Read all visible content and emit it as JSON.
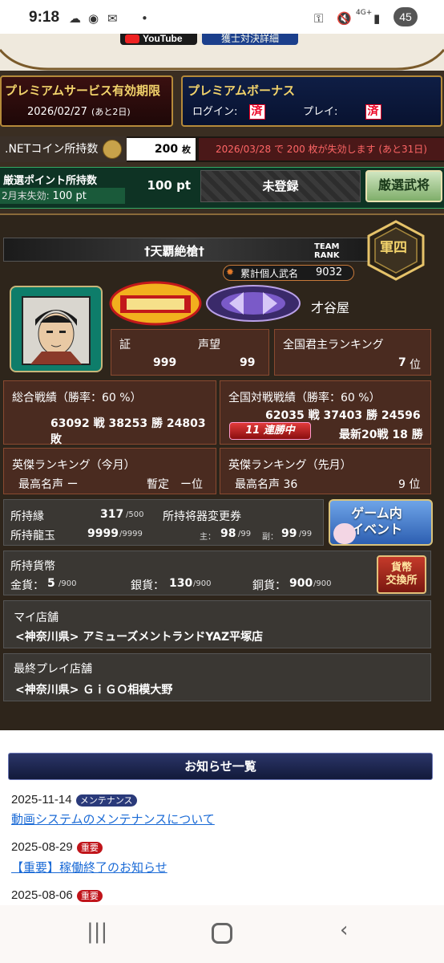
{
  "status": {
    "time": "9:18",
    "battery": "45",
    "network": "4G+"
  },
  "top": {
    "youtube_label": "YouTube",
    "youtube_btn": "獲士対決詳細"
  },
  "premium": {
    "title": "プレミアムサービス有効期限",
    "date": "2026/02/27",
    "remaining": "(あと2日)",
    "bonus_title": "プレミアムボーナス",
    "login_label": "ログイン:",
    "login_val": "済",
    "play_label": "プレイ:",
    "play_val": "済"
  },
  "coin": {
    "label": ".NETコイン所持数",
    "value": "200",
    "unit": "枚",
    "expire": "2026/03/28 で 200 枚が失効します (あと31日)"
  },
  "points": {
    "label": "厳選ポイント所持数",
    "expire_label": "2月末失効:",
    "expire_val": "100 pt",
    "value": "100 pt",
    "unregistered": "未登録",
    "button": "厳選武将"
  },
  "profile": {
    "title": "†天覇絶槍†",
    "team_rank_label": "TEAM\nRANK",
    "rank_glyph": "軍四",
    "heimei_label": "累計個人武名",
    "heimei_value": "9032",
    "store_name": "才谷屋"
  },
  "stats": {
    "shou_label": "証",
    "seibou_label": "声望",
    "shou_val": "999",
    "seibou_val": "99",
    "kunshu_label": "全国君主ランキング",
    "kunshu_val": "7",
    "kunshu_unit": "位",
    "sougo_label": "総合戦績（勝率：60 %）",
    "sougo_vals": "63092 戦 38253 勝 24803 敗",
    "zenkoku_label": "全国対戦戦績（勝率：60 %）",
    "zenkoku_vals": "62035 戦 37403 勝 24596 敗",
    "streak": "11 連勝中",
    "recent20": "最新20戦 18 勝",
    "eiketsu_now_label": "英傑ランキング（今月）",
    "eiketsu_now_meisei": "最高名声 ー",
    "eiketsu_now_rank": "暫定　ー位",
    "eiketsu_prev_label": "英傑ランキング（先月）",
    "eiketsu_prev_meisei": "最高名声 36",
    "eiketsu_prev_rank": "9 位"
  },
  "holdings": {
    "en_label": "所持縁",
    "en_val": "317",
    "en_max": "/500",
    "ryugyoku_label": "所持龍玉",
    "ryugyoku_val": "9999",
    "ryugyoku_max": "/9999",
    "shoki_label": "所持将器変更券",
    "shu_label": "主：",
    "shu_val": "98",
    "shu_max": "/99",
    "fuku_label": "副：",
    "fuku_val": "99",
    "fuku_max": "/99",
    "event_button": "ゲーム内\nイベント"
  },
  "currency": {
    "label": "所持貨幣",
    "gold_label": "金貨：",
    "gold_val": "5",
    "gold_max": "/900",
    "silver_label": "銀貨：",
    "silver_val": "130",
    "silver_max": "/900",
    "copper_label": "銅貨：",
    "copper_val": "900",
    "copper_max": "/900",
    "exchange_button": "貨幣\n交換所"
  },
  "stores": {
    "my_label": "マイ店舗",
    "my_value": "<神奈川県> アミューズメントランドYAZ平塚店",
    "last_label": "最終プレイ店舗",
    "last_value": "<神奈川県> ＧｉＧＯ相模大野"
  },
  "news": {
    "title": "お知らせ一覧",
    "items": [
      {
        "date": "2025-11-14",
        "tag": "メンテナンス",
        "tag_color": "#2a3a7a",
        "text": "動画システムのメンテナンスについて"
      },
      {
        "date": "2025-08-29",
        "tag": "重要",
        "tag_color": "#c0141a",
        "text": "【重要】稼働終了のお知らせ"
      },
      {
        "date": "2025-08-06",
        "tag": "重要",
        "tag_color": "#c0141a",
        "text": ""
      }
    ]
  }
}
